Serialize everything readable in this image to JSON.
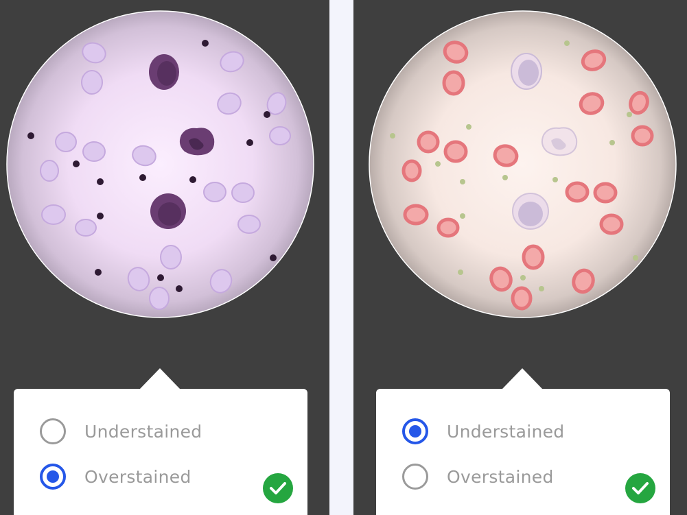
{
  "left_panel": {
    "slide": {
      "variant": "overstained",
      "background_color": "#f1dcf6",
      "cell_color": "#c4a6dc",
      "nucleus_color": "#6a3d72",
      "dot_color": "#2e1a33"
    },
    "options": [
      {
        "label": "Understained",
        "selected": false
      },
      {
        "label": "Overstained",
        "selected": true
      }
    ],
    "result_icon": "check-circle-icon",
    "result_color": "#25a640"
  },
  "right_panel": {
    "slide": {
      "variant": "understained",
      "background_color": "#f8ebe6",
      "cell_color": "#e5767c",
      "nucleus_color": "#cbbbd8",
      "dot_color": "#b7c58e"
    },
    "options": [
      {
        "label": "Understained",
        "selected": true
      },
      {
        "label": "Overstained",
        "selected": false
      }
    ],
    "result_icon": "check-circle-icon",
    "result_color": "#25a640"
  },
  "colors": {
    "panel_background": "#3f3f3f",
    "page_background": "#f3f4fc",
    "selected_radio": "#2557e8",
    "label_text": "#9a9a9a"
  }
}
